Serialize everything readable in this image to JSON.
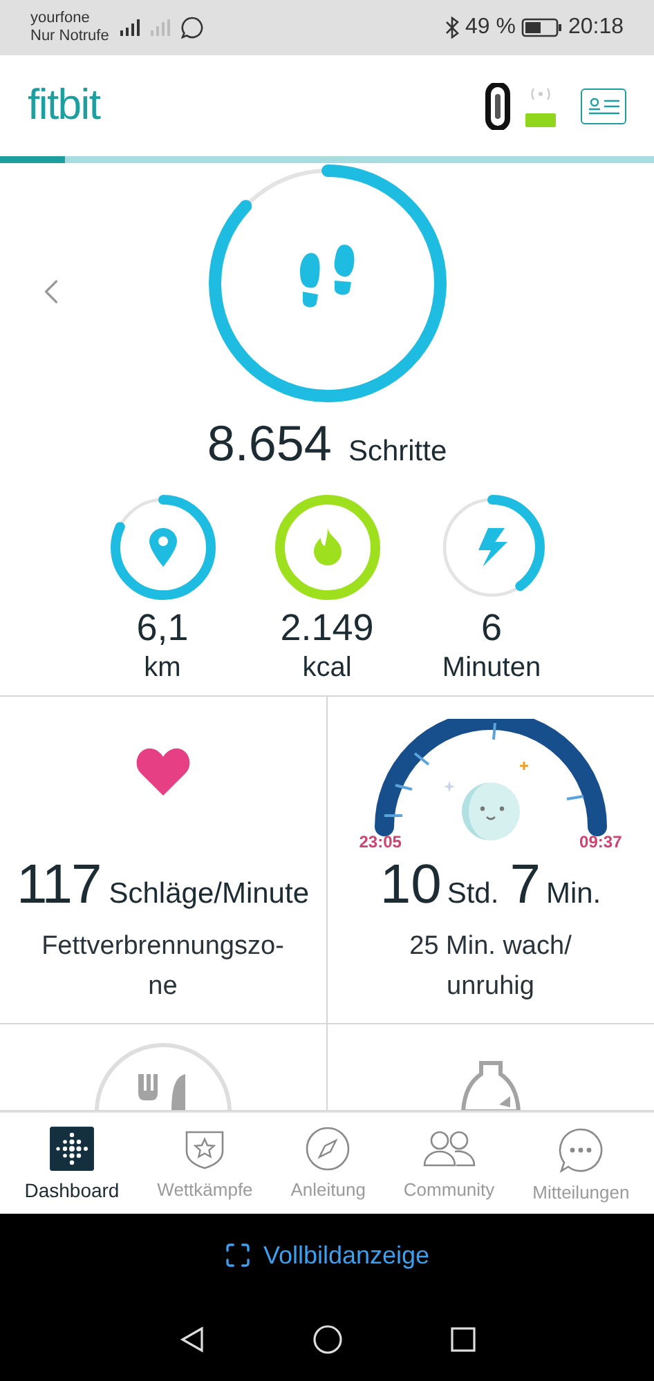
{
  "status_bar": {
    "carrier": "yourfone",
    "network_note": "Nur Notrufe",
    "battery": "49 %",
    "time": "20:18"
  },
  "app_header": {
    "logo": "fitbit"
  },
  "sync_progress": {
    "level": 0.1
  },
  "steps": {
    "value": "8.654",
    "unit": "Schritte",
    "level": 0.87
  },
  "stats": [
    {
      "kind": "distance",
      "value": "6,1",
      "unit": "km",
      "level": 0.82,
      "color": "#1ebce0"
    },
    {
      "kind": "calories",
      "value": "2.149",
      "unit": "kcal",
      "level": 1,
      "color": "#9ee01e"
    },
    {
      "kind": "active_minutes",
      "value": "6",
      "unit": "Minuten",
      "level": 0.4,
      "color": "#1ebce0"
    }
  ],
  "tiles": [
    {
      "kind": "heart",
      "value": "117",
      "unit": "Schläge/Minute",
      "caption_lines": [
        "Fettverbrennungszo-",
        "ne"
      ]
    },
    {
      "kind": "sleep",
      "hours": "10",
      "hours_unit": "Std.",
      "minutes": "7",
      "minutes_unit": "Min.",
      "start": "23:05",
      "end": "09:37",
      "caption_lines": [
        "25 Min. wach/",
        "unruhig"
      ]
    },
    {
      "kind": "food"
    },
    {
      "kind": "water"
    }
  ],
  "nav": [
    {
      "kind": "dashboard",
      "label": "Dashboard",
      "selected": true
    },
    {
      "kind": "challenges",
      "label": "Wettkämpfe",
      "selected": false
    },
    {
      "kind": "guide",
      "label": "Anleitung",
      "selected": false
    },
    {
      "kind": "community",
      "label": "Community",
      "selected": false
    },
    {
      "kind": "messages",
      "label": "Mitteilungen",
      "selected": false
    }
  ],
  "fullscreen_button": "Vollbildanzeige"
}
